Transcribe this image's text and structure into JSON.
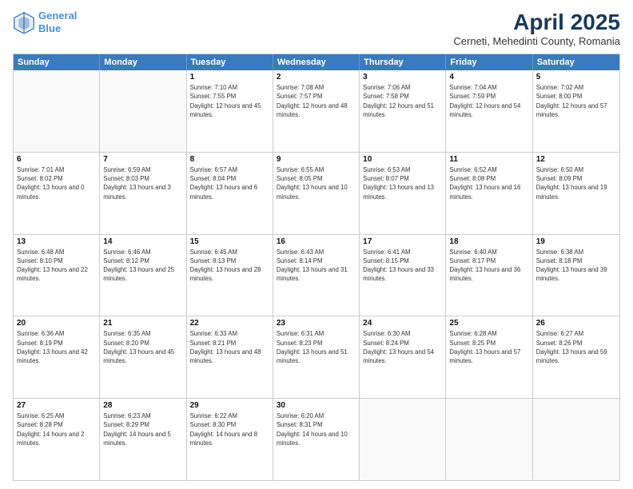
{
  "header": {
    "logo_line1": "General",
    "logo_line2": "Blue",
    "title": "April 2025",
    "subtitle": "Cerneti, Mehedinti County, Romania"
  },
  "days_of_week": [
    "Sunday",
    "Monday",
    "Tuesday",
    "Wednesday",
    "Thursday",
    "Friday",
    "Saturday"
  ],
  "weeks": [
    [
      {
        "day": "",
        "empty": true
      },
      {
        "day": "",
        "empty": true
      },
      {
        "day": "1",
        "sunrise": "7:10 AM",
        "sunset": "7:55 PM",
        "daylight": "12 hours and 45 minutes."
      },
      {
        "day": "2",
        "sunrise": "7:08 AM",
        "sunset": "7:57 PM",
        "daylight": "12 hours and 48 minutes."
      },
      {
        "day": "3",
        "sunrise": "7:06 AM",
        "sunset": "7:58 PM",
        "daylight": "12 hours and 51 minutes."
      },
      {
        "day": "4",
        "sunrise": "7:04 AM",
        "sunset": "7:59 PM",
        "daylight": "12 hours and 54 minutes."
      },
      {
        "day": "5",
        "sunrise": "7:02 AM",
        "sunset": "8:00 PM",
        "daylight": "12 hours and 57 minutes."
      }
    ],
    [
      {
        "day": "6",
        "sunrise": "7:01 AM",
        "sunset": "8:02 PM",
        "daylight": "13 hours and 0 minutes."
      },
      {
        "day": "7",
        "sunrise": "6:59 AM",
        "sunset": "8:03 PM",
        "daylight": "13 hours and 3 minutes."
      },
      {
        "day": "8",
        "sunrise": "6:57 AM",
        "sunset": "8:04 PM",
        "daylight": "13 hours and 6 minutes."
      },
      {
        "day": "9",
        "sunrise": "6:55 AM",
        "sunset": "8:05 PM",
        "daylight": "13 hours and 10 minutes."
      },
      {
        "day": "10",
        "sunrise": "6:53 AM",
        "sunset": "8:07 PM",
        "daylight": "13 hours and 13 minutes."
      },
      {
        "day": "11",
        "sunrise": "6:52 AM",
        "sunset": "8:08 PM",
        "daylight": "13 hours and 16 minutes."
      },
      {
        "day": "12",
        "sunrise": "6:50 AM",
        "sunset": "8:09 PM",
        "daylight": "13 hours and 19 minutes."
      }
    ],
    [
      {
        "day": "13",
        "sunrise": "6:48 AM",
        "sunset": "8:10 PM",
        "daylight": "13 hours and 22 minutes."
      },
      {
        "day": "14",
        "sunrise": "6:46 AM",
        "sunset": "8:12 PM",
        "daylight": "13 hours and 25 minutes."
      },
      {
        "day": "15",
        "sunrise": "6:45 AM",
        "sunset": "8:13 PM",
        "daylight": "13 hours and 28 minutes."
      },
      {
        "day": "16",
        "sunrise": "6:43 AM",
        "sunset": "8:14 PM",
        "daylight": "13 hours and 31 minutes."
      },
      {
        "day": "17",
        "sunrise": "6:41 AM",
        "sunset": "8:15 PM",
        "daylight": "13 hours and 33 minutes."
      },
      {
        "day": "18",
        "sunrise": "6:40 AM",
        "sunset": "8:17 PM",
        "daylight": "13 hours and 36 minutes."
      },
      {
        "day": "19",
        "sunrise": "6:38 AM",
        "sunset": "8:18 PM",
        "daylight": "13 hours and 39 minutes."
      }
    ],
    [
      {
        "day": "20",
        "sunrise": "6:36 AM",
        "sunset": "8:19 PM",
        "daylight": "13 hours and 42 minutes."
      },
      {
        "day": "21",
        "sunrise": "6:35 AM",
        "sunset": "8:20 PM",
        "daylight": "13 hours and 45 minutes."
      },
      {
        "day": "22",
        "sunrise": "6:33 AM",
        "sunset": "8:21 PM",
        "daylight": "13 hours and 48 minutes."
      },
      {
        "day": "23",
        "sunrise": "6:31 AM",
        "sunset": "8:23 PM",
        "daylight": "13 hours and 51 minutes."
      },
      {
        "day": "24",
        "sunrise": "6:30 AM",
        "sunset": "8:24 PM",
        "daylight": "13 hours and 54 minutes."
      },
      {
        "day": "25",
        "sunrise": "6:28 AM",
        "sunset": "8:25 PM",
        "daylight": "13 hours and 57 minutes."
      },
      {
        "day": "26",
        "sunrise": "6:27 AM",
        "sunset": "8:26 PM",
        "daylight": "13 hours and 59 minutes."
      }
    ],
    [
      {
        "day": "27",
        "sunrise": "6:25 AM",
        "sunset": "8:28 PM",
        "daylight": "14 hours and 2 minutes."
      },
      {
        "day": "28",
        "sunrise": "6:23 AM",
        "sunset": "8:29 PM",
        "daylight": "14 hours and 5 minutes."
      },
      {
        "day": "29",
        "sunrise": "6:22 AM",
        "sunset": "8:30 PM",
        "daylight": "14 hours and 8 minutes."
      },
      {
        "day": "30",
        "sunrise": "6:20 AM",
        "sunset": "8:31 PM",
        "daylight": "14 hours and 10 minutes."
      },
      {
        "day": "",
        "empty": true
      },
      {
        "day": "",
        "empty": true
      },
      {
        "day": "",
        "empty": true
      }
    ]
  ]
}
